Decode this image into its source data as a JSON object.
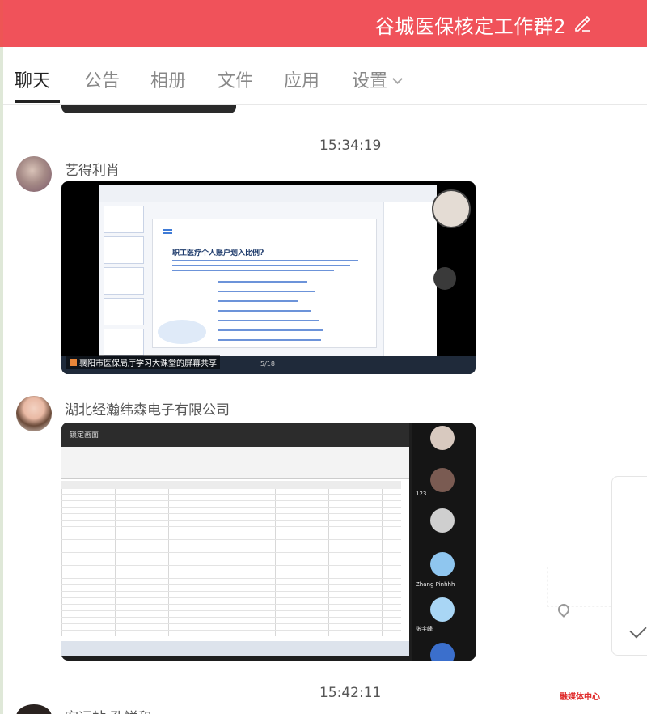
{
  "group": {
    "title": "谷城医保核定工作群2"
  },
  "tabs": [
    {
      "label": "聊天",
      "active": true
    },
    {
      "label": "公告"
    },
    {
      "label": "相册"
    },
    {
      "label": "文件"
    },
    {
      "label": "应用"
    },
    {
      "label": "设置"
    }
  ],
  "messages": [
    {
      "time": "15:34:19",
      "sender": "艺得利肖",
      "image": {
        "slide_title": "职工医疗个人账户划入比例?",
        "share_label": "襄阳市医保局厅学习大课堂的屏幕共享",
        "page": "5/18"
      }
    },
    {
      "sender": "湖北经瀚纬森电子有限公司",
      "image": {
        "top_label": "锁定画面",
        "participants": [
          "123",
          "Zhang Pinhhh",
          "张宇峰"
        ]
      }
    },
    {
      "time": "15:42:11",
      "sender": "客运站 孔祥和"
    }
  ],
  "watermark": "融媒体中心",
  "colors": {
    "title_bar": "#f0525a",
    "accent_red": "#e02a2a"
  }
}
